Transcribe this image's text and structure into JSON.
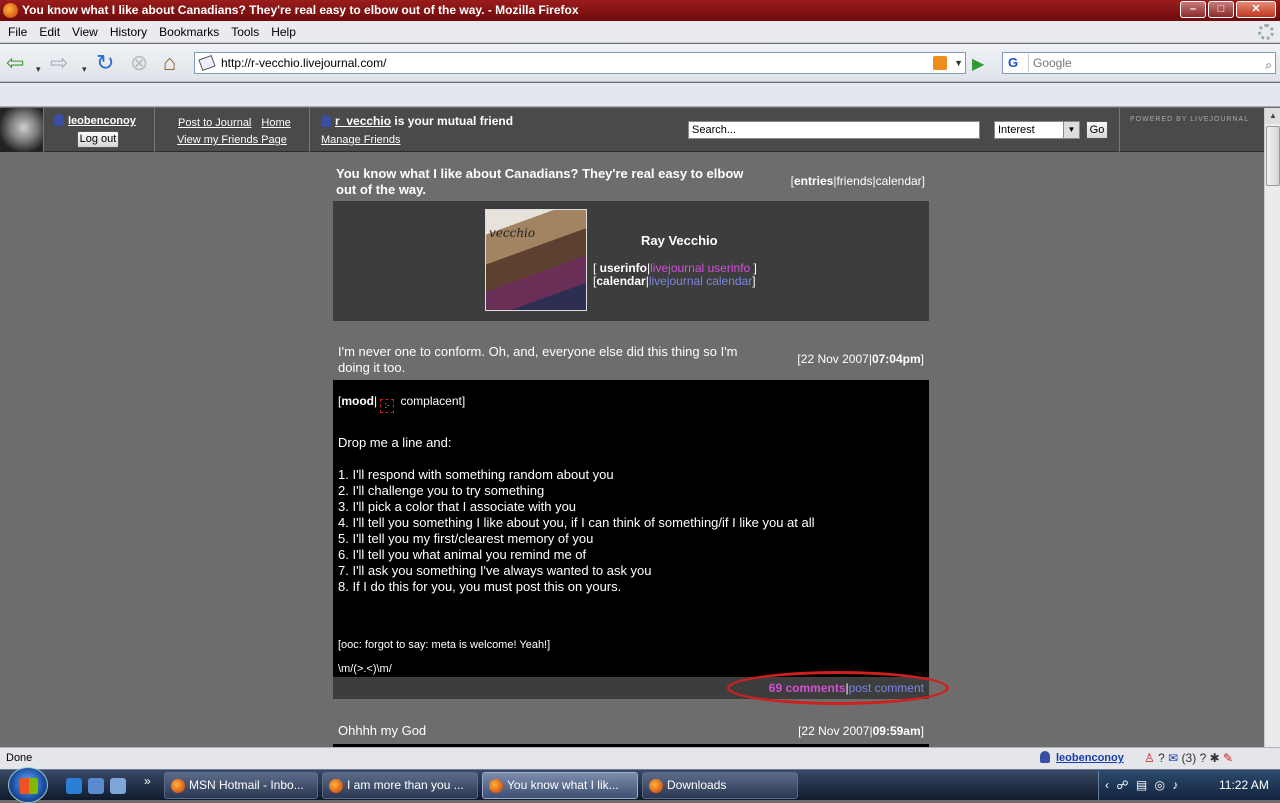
{
  "window": {
    "title": "You know what I like about Canadians? They're real easy to elbow out of the way. - Mozilla Firefox",
    "minimize": "–",
    "maximize": "□",
    "close": "✕"
  },
  "menu": [
    "File",
    "Edit",
    "View",
    "History",
    "Bookmarks",
    "Tools",
    "Help"
  ],
  "nav": {
    "url": "http://r-vecchio.livejournal.com/",
    "search_placeholder": "Google",
    "search_engine": "G"
  },
  "ljbar": {
    "username": "leobenconoy",
    "logout": "Log out",
    "post": "Post to Journal",
    "home": "Home",
    "friends_page": "View my Friends Page",
    "mutual_user": "r_vecchio",
    "mutual_text": " is your mutual friend",
    "manage_friends": "Manage Friends",
    "search_placeholder": "Search...",
    "search_type": "Interest",
    "go": "Go",
    "powered": "POWERED BY LIVEJOURNAL"
  },
  "journal": {
    "title": "You know what I like about Canadians? They're real easy to elbow out of the way.",
    "nav_entries": "entries",
    "nav_friends": "friends",
    "nav_calendar": "calendar",
    "name": "Ray Vecchio",
    "pic_text": "vecchio",
    "userinfo": "userinfo",
    "lj_userinfo": "livejournal userinfo",
    "calendar": "calendar",
    "lj_calendar": "livejournal calendar"
  },
  "entry1": {
    "subject": "I'm never one to conform. Oh, and, everyone else did this thing so I'm doing it too.",
    "date": "22 Nov 2007",
    "time": "07:04pm",
    "mood_label": "mood",
    "mood": "complacent",
    "intro": "Drop me a line and:",
    "items": [
      "1. I'll respond with something random about you",
      "2. I'll challenge you to try something",
      "3. I'll pick a color that I associate with you",
      "4. I'll tell you something I like about you, if I can think of something/if I like you at all",
      "5. I'll tell you my first/clearest memory of you",
      "6. I'll tell you what animal you remind me of",
      "7. I'll ask you something I've always wanted to ask you",
      "8. If I do this for you, you must post this on yours."
    ],
    "ooc": "[ooc: forgot to say: meta is welcome! Yeah!]",
    "emoticon": "\\m/(>.<)\\m/",
    "comments": "69 comments",
    "post_comment": "post comment"
  },
  "entry2": {
    "subject": "Ohhhh my God",
    "date": "22 Nov 2007",
    "time": "09:59am"
  },
  "status": {
    "text": "Done",
    "user": "leobenconoy",
    "mail_count": "(3)"
  },
  "taskbar": {
    "items": [
      "MSN Hotmail - Inbo...",
      "I am more than you ...",
      "You know what I lik...",
      "Downloads"
    ],
    "clock": "11:22 AM"
  }
}
